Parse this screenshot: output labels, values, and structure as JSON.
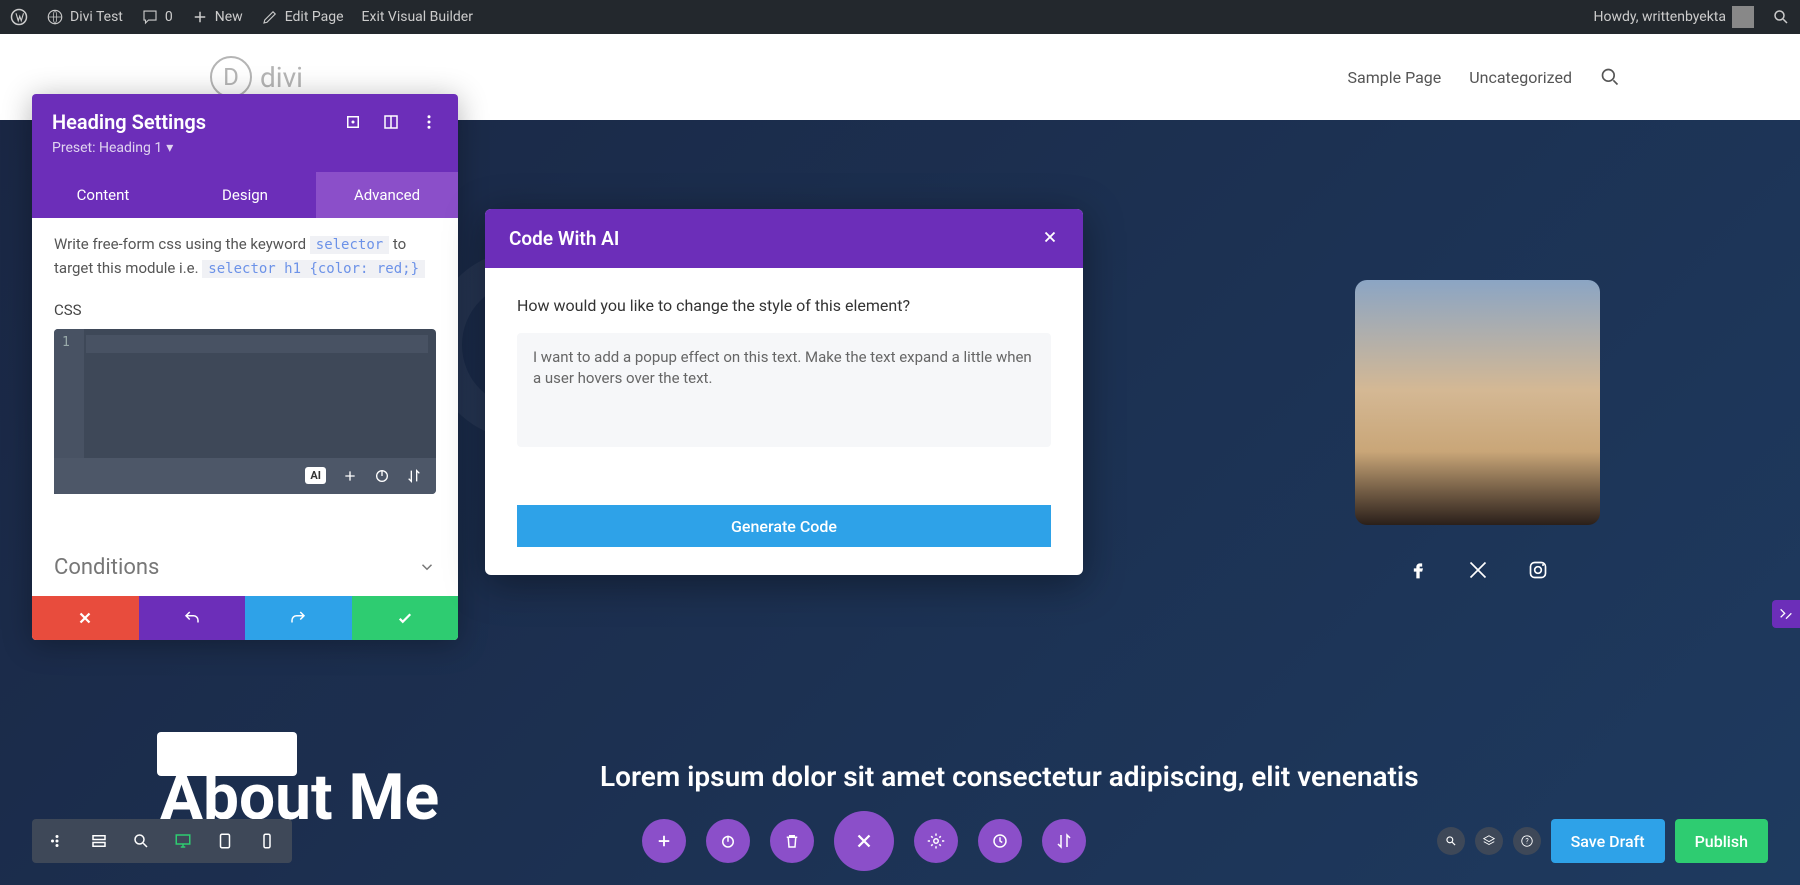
{
  "adminbar": {
    "site": "Divi Test",
    "comments": "0",
    "new": "New",
    "edit": "Edit Page",
    "exit": "Exit Visual Builder",
    "howdy": "Howdy, writtenbyekta"
  },
  "header": {
    "logo": "divi",
    "nav": [
      "Sample Page",
      "Uncategorized"
    ]
  },
  "settings": {
    "title": "Heading Settings",
    "preset": "Preset: Heading 1",
    "tabs": [
      "Content",
      "Design",
      "Advanced"
    ],
    "hint_a": "Write free-form css using the keyword ",
    "code_a": "selector",
    "hint_b": "  to target this module i.e. ",
    "code_b": "selector h1 {color: red;}",
    "css_label": "CSS",
    "line": "1",
    "ai": "AI",
    "conditions": "Conditions"
  },
  "ai": {
    "title": "Code With AI",
    "question": "How would you like to change the style of this element?",
    "input": "I want to add a popup effect on this text. Make the text expand a little when a user hovers over the text. ",
    "button": "Generate Code"
  },
  "hero": {
    "heading": "About Me",
    "sub": "Lorem ipsum dolor sit amet consectetur adipiscing, elit venenatis"
  },
  "bottombar": {
    "save": "Save Draft",
    "publish": "Publish"
  }
}
